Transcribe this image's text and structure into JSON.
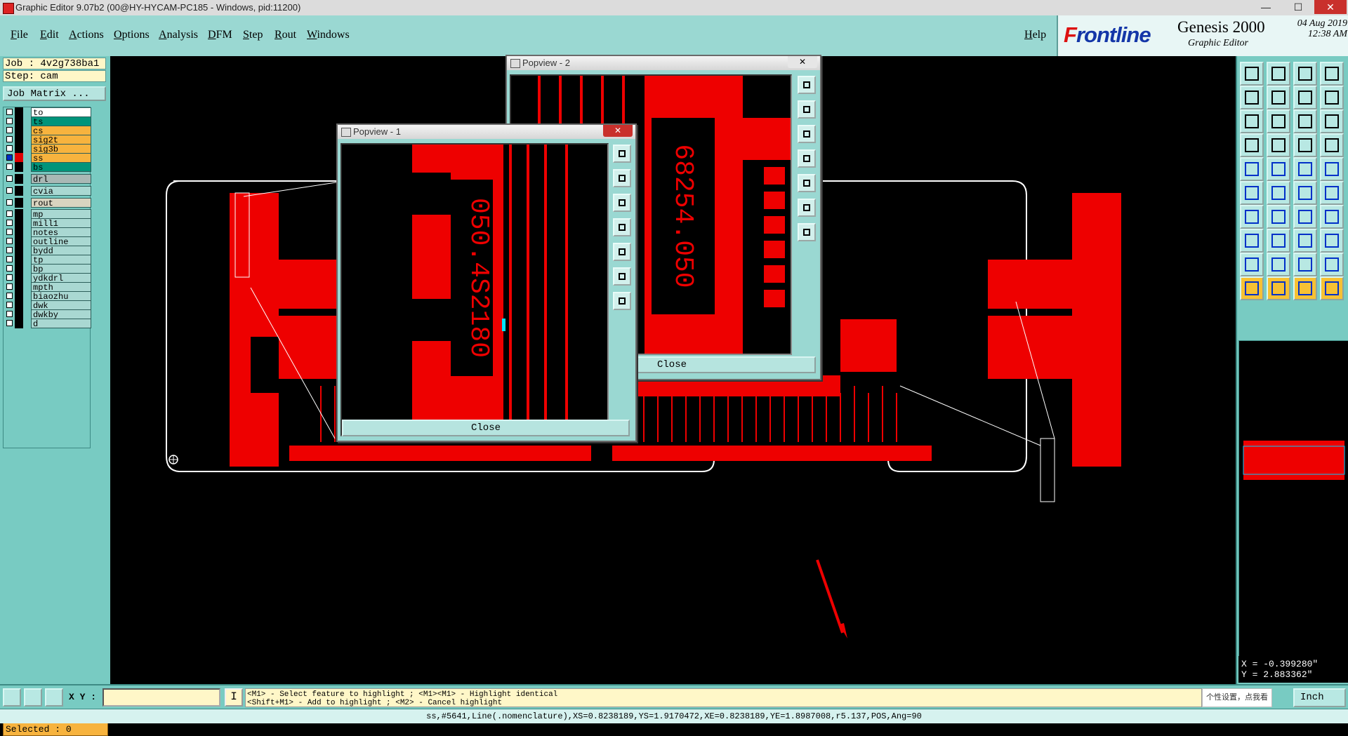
{
  "window": {
    "title": "Graphic Editor 9.07b2 (00@HY-HYCAM-PC185 - Windows, pid:11200)",
    "minimize": "—",
    "maximize": "☐",
    "close": "✕"
  },
  "menu": [
    "File",
    "Edit",
    "Actions",
    "Options",
    "Analysis",
    "DFM",
    "Step",
    "Rout",
    "Windows"
  ],
  "help": "Help",
  "brand": {
    "logo_a": "F",
    "logo_b": "rontline",
    "product": "Genesis 2000",
    "subtitle": "Graphic Editor",
    "date": "04 Aug 2019",
    "time": "12:38 AM"
  },
  "job": {
    "job": "Job : 4v2g738ba1",
    "step": "Step: cam",
    "matrix_button": "Job Matrix ..."
  },
  "layers": [
    {
      "name": "to",
      "color": "#ffffff",
      "swatch": "#000000",
      "checked": false
    },
    {
      "name": "ts",
      "color": "#00947a",
      "swatch": "#000000",
      "checked": false
    },
    {
      "name": "cs",
      "color": "#f7b33e",
      "swatch": "#000000",
      "checked": false
    },
    {
      "name": "sig2t",
      "color": "#f7b33e",
      "swatch": "#000000",
      "checked": false
    },
    {
      "name": "sig3b",
      "color": "#f7b33e",
      "swatch": "#000000",
      "checked": false
    },
    {
      "name": "ss",
      "color": "#f7b33e",
      "swatch": "#e00000",
      "checked": true
    },
    {
      "name": "bs",
      "color": "#00947a",
      "swatch": "#000000",
      "checked": false
    },
    {
      "name": "drl",
      "color": "#a9b8b5",
      "swatch": "#000000",
      "checked": false
    },
    {
      "name": "cvia",
      "color": "#a9d8d2",
      "swatch": "#000000",
      "checked": false
    },
    {
      "name": "rout",
      "color": "#d9d4c0",
      "swatch": "#000000",
      "checked": false
    },
    {
      "name": "mp",
      "color": "#a9d8d2",
      "swatch": "#000000",
      "checked": false
    },
    {
      "name": "mill1",
      "color": "#a9d8d2",
      "swatch": "#000000",
      "checked": false
    },
    {
      "name": "notes",
      "color": "#a9d8d2",
      "swatch": "#000000",
      "checked": false
    },
    {
      "name": "outline",
      "color": "#a9d8d2",
      "swatch": "#000000",
      "checked": false
    },
    {
      "name": "bydd",
      "color": "#a9d8d2",
      "swatch": "#000000",
      "checked": false
    },
    {
      "name": "tp",
      "color": "#a9d8d2",
      "swatch": "#000000",
      "checked": false
    },
    {
      "name": "bp",
      "color": "#a9d8d2",
      "swatch": "#000000",
      "checked": false
    },
    {
      "name": "ydkdrl",
      "color": "#a9d8d2",
      "swatch": "#000000",
      "checked": false
    },
    {
      "name": "mpth",
      "color": "#a9d8d2",
      "swatch": "#000000",
      "checked": false
    },
    {
      "name": "biaozhu",
      "color": "#a9d8d2",
      "swatch": "#000000",
      "checked": false
    },
    {
      "name": "dwk",
      "color": "#a9d8d2",
      "swatch": "#000000",
      "checked": false
    },
    {
      "name": "dwkby",
      "color": "#a9d8d2",
      "swatch": "#000000",
      "checked": false
    },
    {
      "name": "d",
      "color": "#a9d8d2",
      "swatch": "#000000",
      "checked": false
    }
  ],
  "selected": "Selected : 0",
  "popview1": {
    "title": "Popview - 1",
    "label": "050.4S2180",
    "close_button": "Close"
  },
  "popview2": {
    "title": "Popview - 2",
    "label": "68254.050",
    "close_button": "Close"
  },
  "xy_label": "X Y :",
  "xy_value": "",
  "cursor_btn": "I",
  "hints": [
    "<M1> - Select feature to highlight ; <M1><M1> - Highlight identical",
    "<Shift+M1> - Add to highlight ; <M2> - Cancel highlight"
  ],
  "ime_hint": "个性设置，点我看看",
  "units": "Inch",
  "coords": {
    "x": "X = -0.399280\"",
    "y": "Y = 2.883362\""
  },
  "status": "ss,#5641,Line(.nomenclature),XS=0.8238189,YS=1.9170472,XE=0.8238189,YE=1.8987008,r5.137,POS,Ang=90",
  "colors": {
    "copper": "#ff0000",
    "panel": "#78cbc2",
    "menubar": "#9ad8d2",
    "highlight": "#00e5ff"
  },
  "icons": {
    "fit": "zoom-fit-icon",
    "home": "home-icon",
    "scale": "scale-1-2-icon",
    "pointer": "pointer-icon"
  }
}
